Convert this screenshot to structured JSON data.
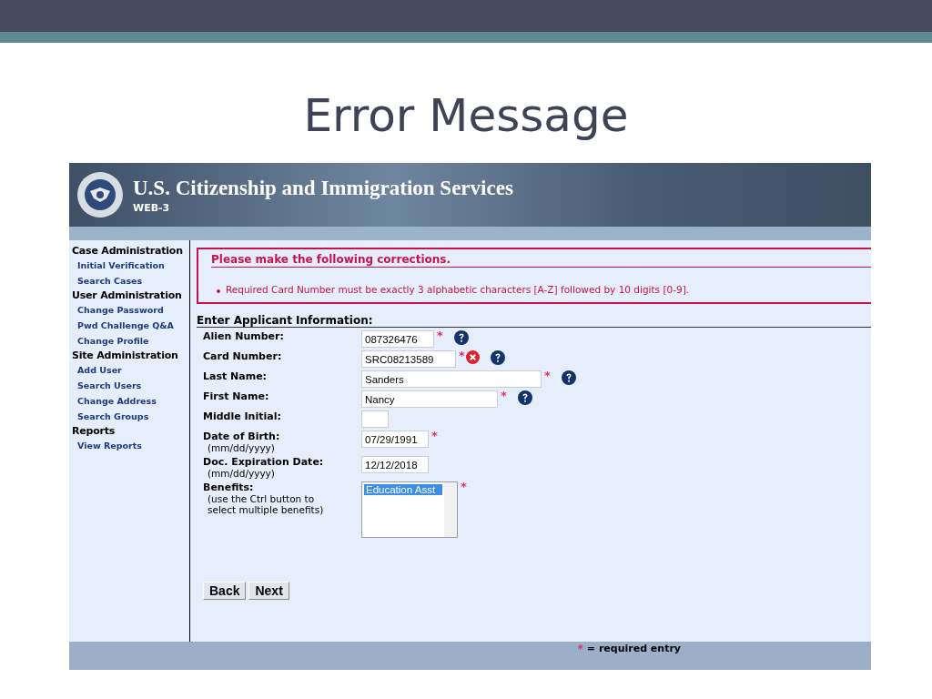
{
  "slide_title": "Error Message",
  "banner": {
    "title": "U.S. Citizenship and Immigration Services",
    "subtitle": "WEB-3"
  },
  "sidebar": [
    {
      "heading": "Case Administration",
      "items": [
        "Initial Verification",
        "Search Cases"
      ]
    },
    {
      "heading": "User Administration",
      "items": [
        "Change Password",
        "Pwd Challenge Q&A",
        "Change Profile"
      ]
    },
    {
      "heading": "Site Administration",
      "items": [
        "Add User",
        "Search Users",
        "Change Address",
        "Search Groups"
      ]
    },
    {
      "heading": "Reports",
      "items": [
        "View Reports"
      ]
    }
  ],
  "error_box": {
    "title": "Please make the following corrections.",
    "errors": [
      "Required Card Number must be exactly 3 alphabetic characters [A-Z] followed by 10 digits [0-9]."
    ]
  },
  "form": {
    "title": "Enter Applicant Information:",
    "fields": [
      {
        "kind": "text",
        "label": "Alien Number:",
        "value": "087326476",
        "required_mark": "*",
        "error": false,
        "help": true
      },
      {
        "kind": "text",
        "label": "Card Number:",
        "value": "SRC08213589",
        "required_mark": "*",
        "error": true,
        "help": true
      },
      {
        "kind": "text",
        "label": "Last Name:",
        "value": "Sanders",
        "required_mark": "*",
        "error": false,
        "help": true
      },
      {
        "kind": "text",
        "label": "First Name:",
        "value": "Nancy",
        "required_mark": "*",
        "error": false,
        "help": true
      },
      {
        "kind": "text",
        "label": "Middle Initial:",
        "error": false,
        "help": false
      },
      {
        "kind": "text",
        "label": "Date of Birth:",
        "hint": "(mm/dd/yyyy)",
        "value": "07/29/1991",
        "required_mark": "*",
        "error": false,
        "help": false
      },
      {
        "kind": "text",
        "label": "Doc. Expiration Date:",
        "hint": "(mm/dd/yyyy)",
        "value": "12/12/2018",
        "error": false,
        "help": false
      },
      {
        "kind": "listbox",
        "label": "Benefits:",
        "hint": "(use the Ctrl button to select multiple benefits)",
        "options": [
          {
            "label": "Education Asst",
            "selected": true
          }
        ],
        "required_mark": "*",
        "error": false,
        "help": false
      }
    ]
  },
  "buttons": [
    "Back",
    "Next"
  ],
  "footer": {
    "required_mark": "*",
    "text": "= required entry"
  }
}
